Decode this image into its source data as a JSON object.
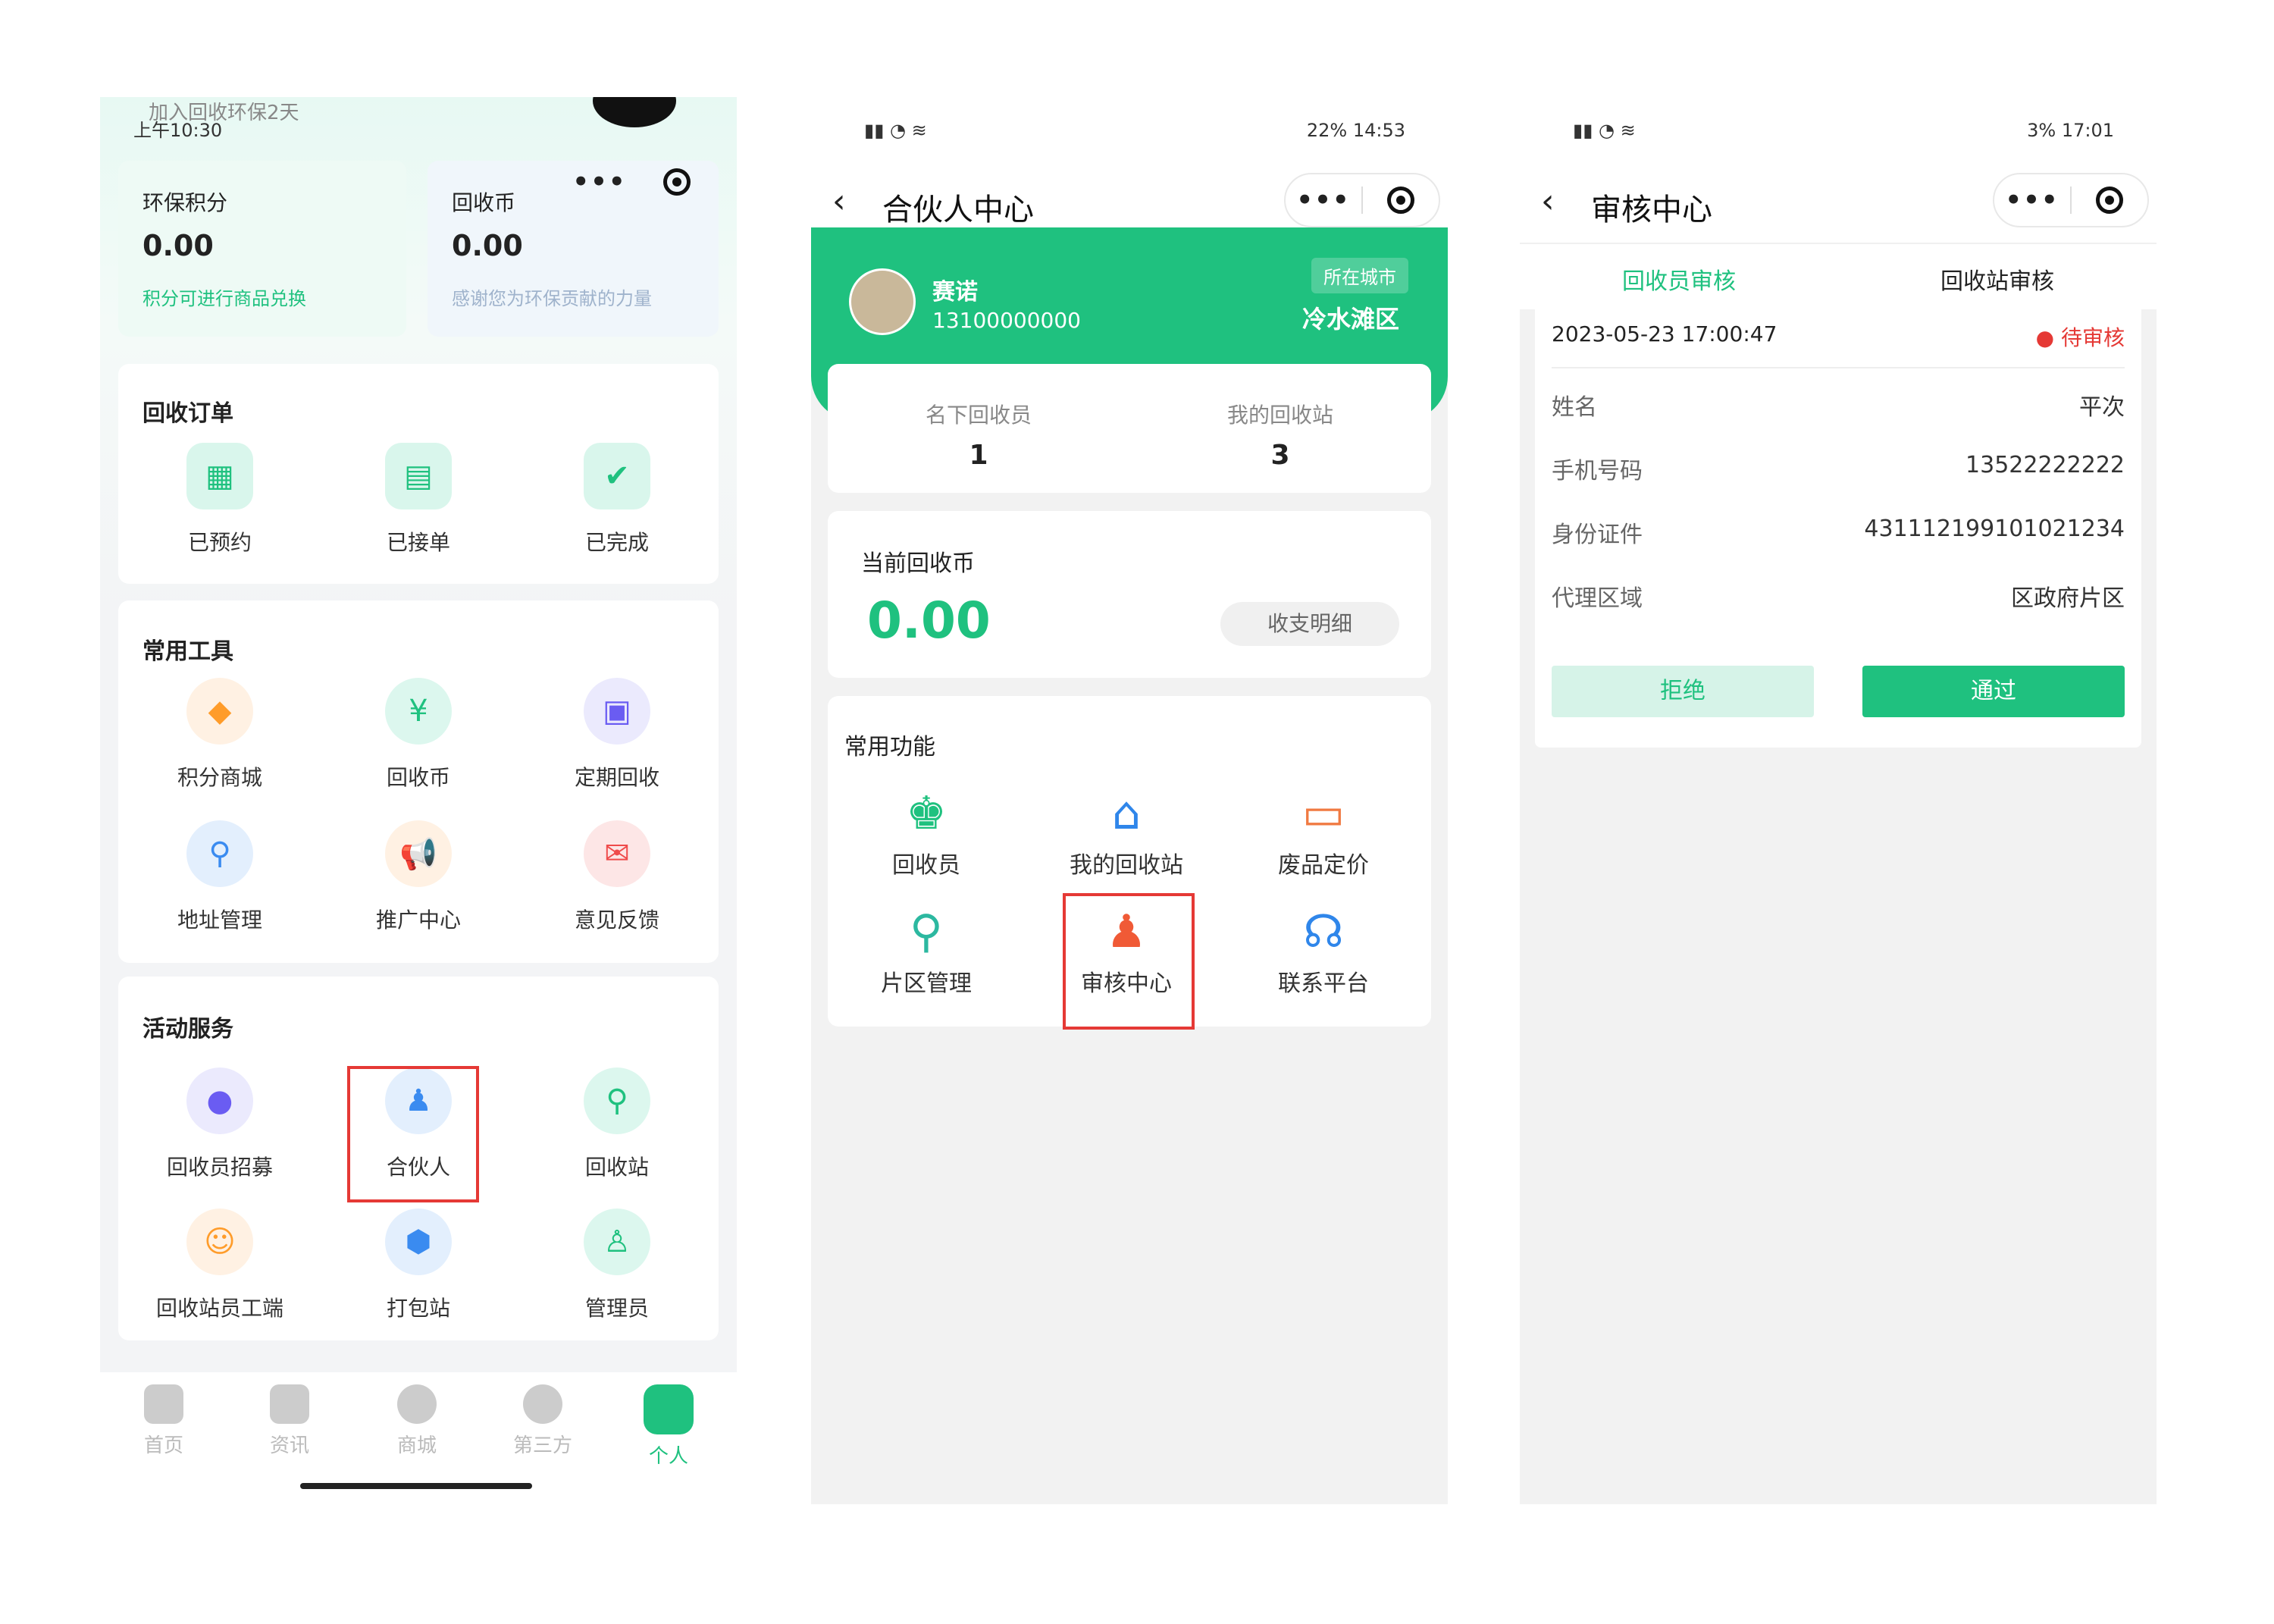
{
  "p1": {
    "status_time": "上午10:30",
    "notice": "加入回收环保2天",
    "score_label": "环保积分",
    "score_value": "0.00",
    "score_hint": "积分可进行商品兑换",
    "coin_label": "回收币",
    "coin_value": "0.00",
    "coin_hint": "感谢您为环保贡献的力量",
    "orders_title": "回收订单",
    "orders": [
      "已预约",
      "已接单",
      "已完成"
    ],
    "tools_title": "常用工具",
    "tools": [
      "积分商城",
      "回收币",
      "定期回收",
      "地址管理",
      "推广中心",
      "意见反馈"
    ],
    "services_title": "活动服务",
    "services": [
      "回收员招募",
      "合伙人",
      "回收站",
      "回收站员工端",
      "打包站",
      "管理员"
    ],
    "tabs": [
      "首页",
      "资讯",
      "商城",
      "第三方",
      "个人"
    ]
  },
  "p2": {
    "status_right": "22%  14:53",
    "title": "合伙人中心",
    "name": "赛诺",
    "phone": "13100000000",
    "city_label": "所在城市",
    "city": "冷水滩区",
    "stat1_label": "名下回收员",
    "stat1_value": "1",
    "stat2_label": "我的回收站",
    "stat2_value": "3",
    "coin_label": "当前回收币",
    "coin_value": "0.00",
    "detail_btn": "收支明细",
    "func_title": "常用功能",
    "funcs": [
      "回收员",
      "我的回收站",
      "废品定价",
      "片区管理",
      "审核中心",
      "联系平台"
    ]
  },
  "p3": {
    "status_right": "3%  17:01",
    "title": "审核中心",
    "tab1": "回收员审核",
    "tab2": "回收站审核",
    "datetime": "2023-05-23 17:00:47",
    "status": "待审核",
    "rows": [
      {
        "k": "姓名",
        "v": "平次"
      },
      {
        "k": "手机号码",
        "v": "13522222222"
      },
      {
        "k": "身份证件",
        "v": "431112199101021234"
      },
      {
        "k": "代理区域",
        "v": "区政府片区"
      }
    ],
    "reject": "拒绝",
    "approve": "通过"
  },
  "colors": {
    "green": "#1fc17f",
    "red": "#e53935"
  }
}
